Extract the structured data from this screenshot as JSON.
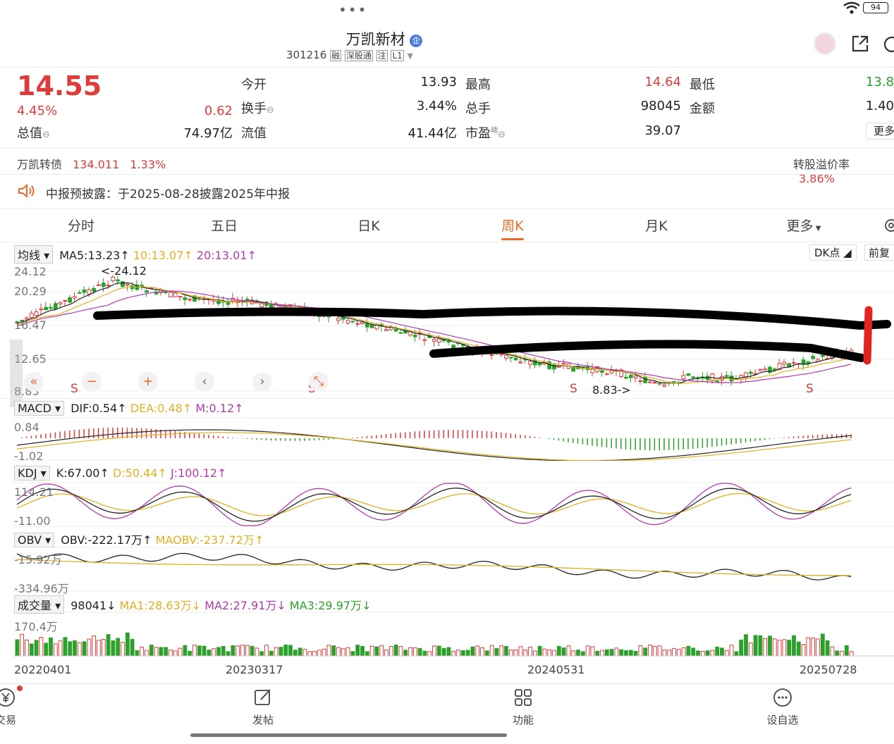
{
  "status": {
    "battery": "94"
  },
  "stock": {
    "name": "万凯新材",
    "name_badge": "企",
    "code": "301216",
    "tags": [
      "融",
      "深股通",
      "注",
      "L1"
    ],
    "price": "14.55",
    "change_pct": "4.45%",
    "change_amt": "0.62",
    "fields": [
      {
        "label": "今开",
        "value": "13.93"
      },
      {
        "label": "最高",
        "value": "14.64"
      },
      {
        "label": "最低",
        "value": "13.8"
      },
      {
        "label": "换手",
        "value": "3.44%"
      },
      {
        "label": "总手",
        "value": "98045"
      },
      {
        "label": "金额",
        "value": "1.40"
      },
      {
        "label": "总值",
        "value": "74.97亿"
      },
      {
        "label": "流值",
        "value": "41.44亿"
      },
      {
        "label": "市盈",
        "value": "39.07"
      }
    ],
    "pe_suffix": "动",
    "more_btn": "更多"
  },
  "bond": {
    "name": "万凯转债",
    "price": "134.011",
    "pct": "1.33%",
    "premium_label": "转股溢价率",
    "premium": "3.86%"
  },
  "notice": {
    "text": "中报预披露：于2025-08-28披露2025年中报"
  },
  "tabs": [
    "分时",
    "五日",
    "日K",
    "周K",
    "月K",
    "更多"
  ],
  "active_tab": "周K",
  "kline": {
    "ma_selector": "均线",
    "ma5": "MA5:13.23",
    "ma10": "10:13.07",
    "ma20": "20:13.01",
    "right_btn1": "DK点",
    "right_btn2": "前复",
    "y_labels": [
      "24.12",
      "20.29",
      "16.47",
      "12.65",
      "8.83"
    ],
    "high_mark": "<-24.12",
    "low_mark": "8.83->",
    "s_marks": [
      "S",
      "S",
      "S",
      "S"
    ]
  },
  "macd": {
    "selector": "MACD",
    "dif": "DIF:0.54",
    "dea": "DEA:0.48",
    "m": "M:0.12",
    "y_top": "0.84",
    "y_bottom": "-1.02"
  },
  "kdj": {
    "selector": "KDJ",
    "k": "K:67.00",
    "d": "D:50.44",
    "j": "J:100.12",
    "y_top": "114.21",
    "y_bottom": "-11.00"
  },
  "obv": {
    "selector": "OBV",
    "obv": "OBV:-222.17万",
    "maobv": "MAOBV:-237.72万",
    "y_top": "-15.92万",
    "y_bottom": "-334.96万"
  },
  "volume": {
    "selector": "成交量",
    "vol": "98041",
    "ma1": "MA1:28.63万",
    "ma2": "MA2:27.91万",
    "ma3": "MA3:29.97万",
    "y_top": "170.4万"
  },
  "dates": [
    "20220401",
    "20230317",
    "20240531",
    "20250728"
  ],
  "bottom_nav": [
    {
      "label": "交易",
      "icon": "yen-icon"
    },
    {
      "label": "发帖",
      "icon": "edit-icon"
    },
    {
      "label": "功能",
      "icon": "grid-icon"
    },
    {
      "label": "设自选",
      "icon": "more-icon"
    }
  ],
  "colors": {
    "up": "#e03b3b",
    "down": "#2aa12a",
    "accent": "#e8692d",
    "ma5": "#222222",
    "ma10": "#e0b020",
    "ma20": "#b03ab0"
  }
}
